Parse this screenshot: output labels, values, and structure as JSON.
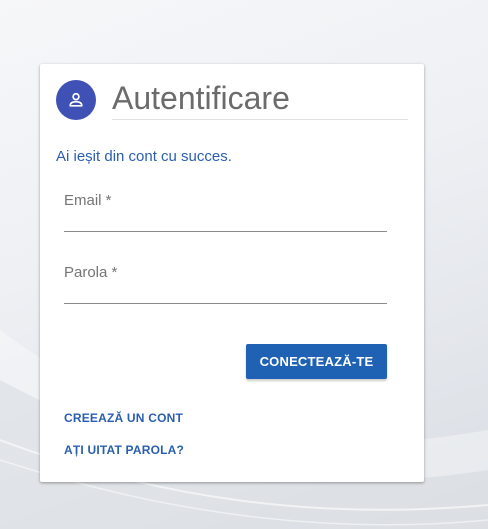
{
  "login": {
    "title": "Autentificare",
    "status_message": "Ai ieșit din cont cu succes.",
    "email_label": "Email *",
    "password_label": "Parola *",
    "submit_label": "CONECTEAZĂ-TE",
    "create_account_label": "CREEAZĂ UN CONT",
    "forgot_password_label": "AȚI UITAT PAROLA?",
    "avatar_icon": "person-icon"
  },
  "colors": {
    "avatar_bg": "#3f51b5",
    "primary": "#1f62b4",
    "link": "#2a5fb0"
  }
}
